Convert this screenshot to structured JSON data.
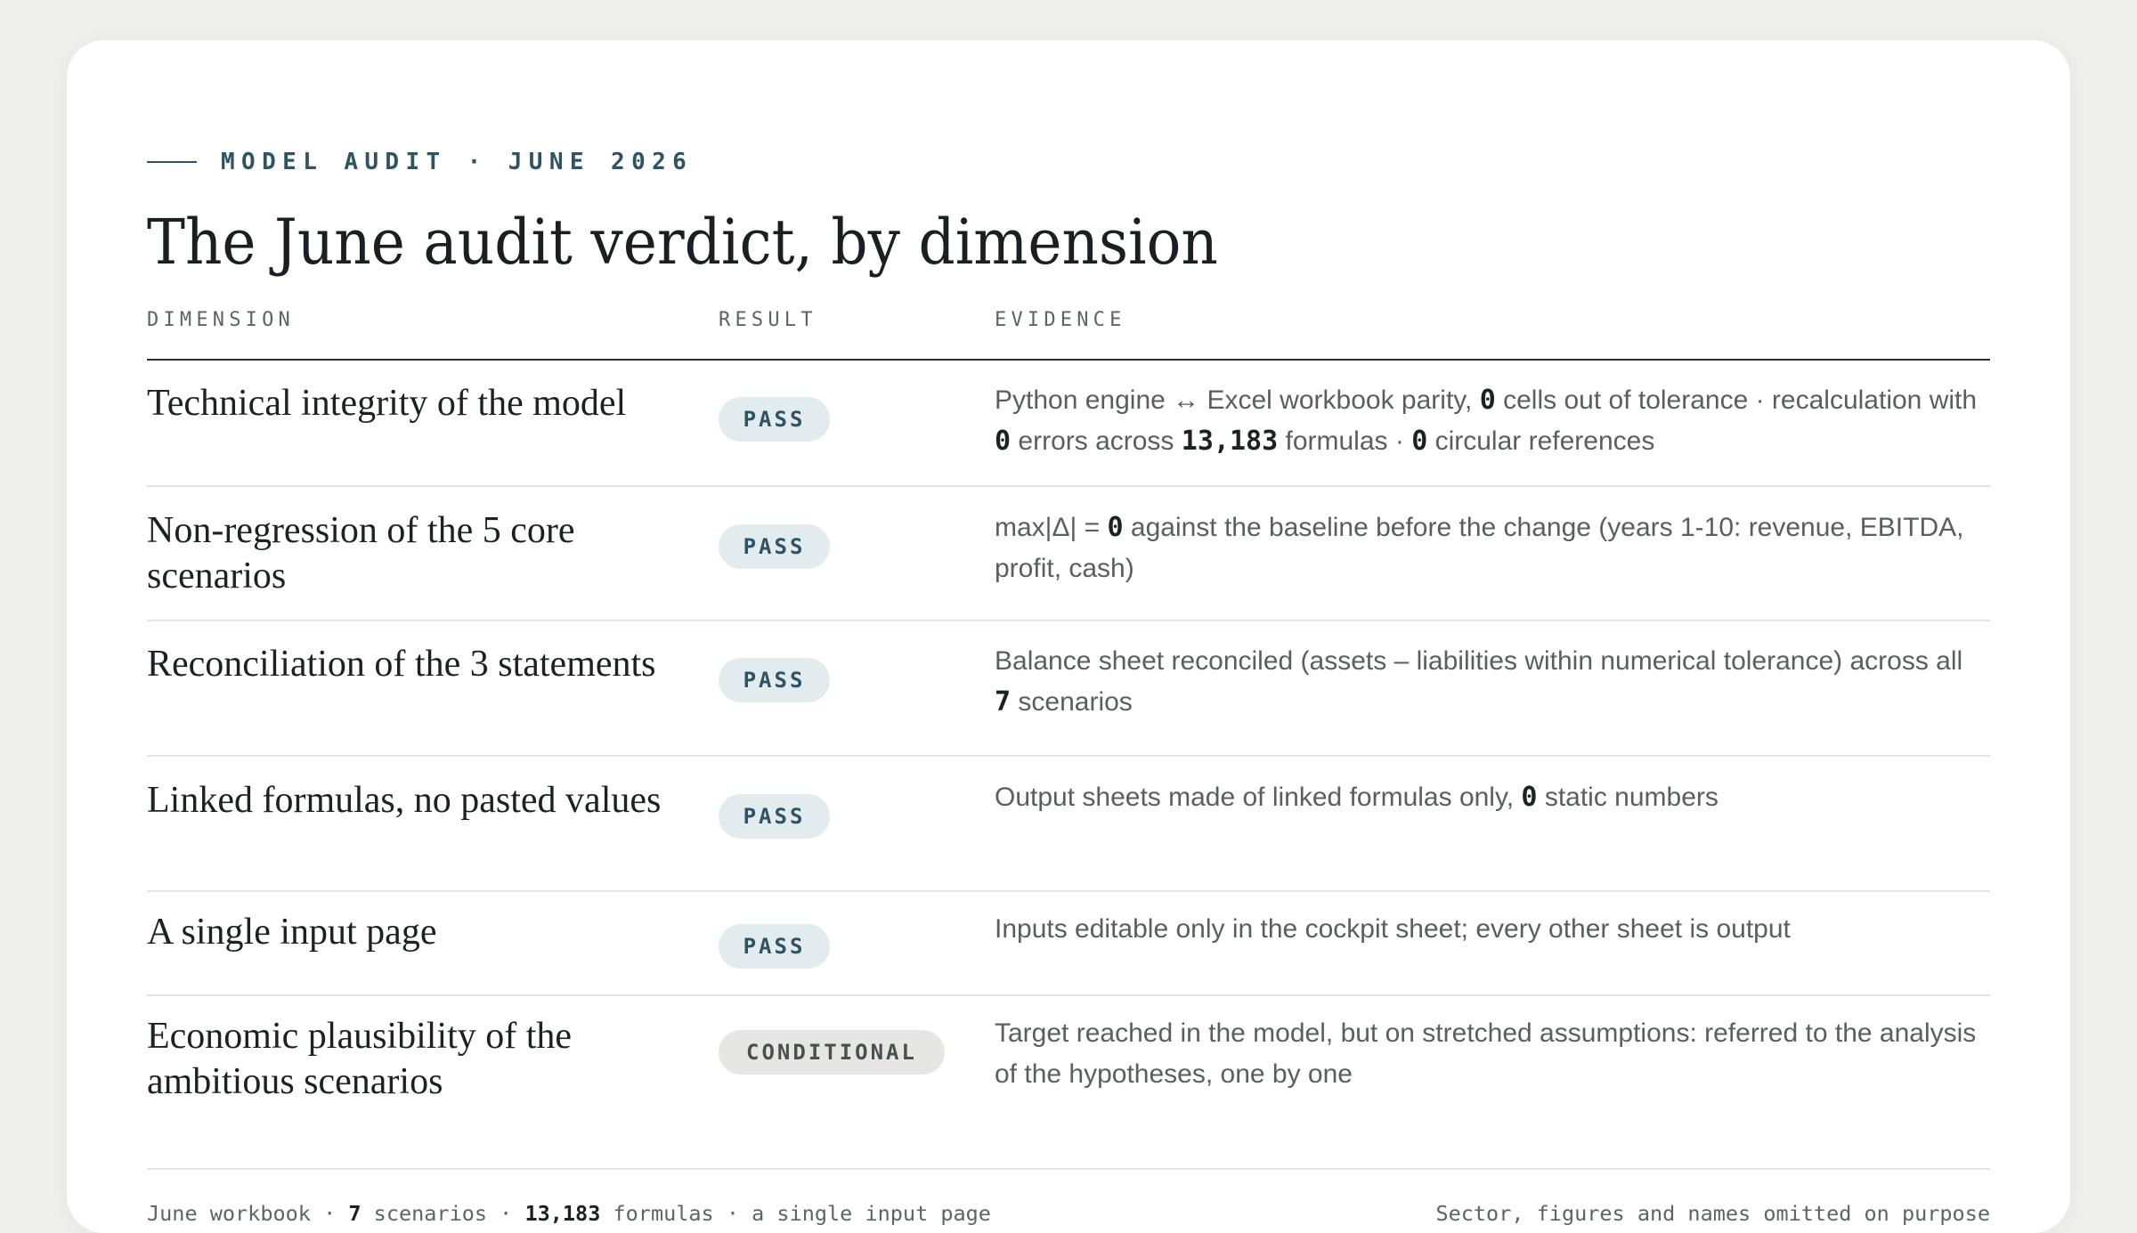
{
  "eyebrow": "MODEL AUDIT · JUNE 2026",
  "title": "The June audit verdict, by dimension",
  "columns": {
    "dimension": "DIMENSION",
    "result": "RESULT",
    "evidence": "EVIDENCE"
  },
  "rows": [
    {
      "dimension": "Technical integrity of the model",
      "result": "PASS",
      "evidence": {
        "t1": "Python engine ↔ Excel workbook parity, ",
        "n1": "0",
        "t2": " cells out of tolerance · recalculation with ",
        "n2": "0",
        "t3": " errors across ",
        "n3": "13,183",
        "t4": " formulas · ",
        "n4": "0",
        "t5": " circular references"
      }
    },
    {
      "dimension": "Non-regression of the 5 core scenarios",
      "result": "PASS",
      "evidence": {
        "t1": "max|Δ| = ",
        "n1": "0",
        "t2": " against the baseline before the change (years 1-10: revenue, EBITDA, profit, cash)"
      }
    },
    {
      "dimension": "Reconciliation of the 3 statements",
      "result": "PASS",
      "evidence": {
        "t1": "Balance sheet reconciled (assets – liabilities within numerical tolerance) across all ",
        "n1": "7",
        "t2": " scenarios"
      }
    },
    {
      "dimension": "Linked formulas, no pasted values",
      "result": "PASS",
      "evidence": {
        "t1": "Output sheets made of linked formulas only, ",
        "n1": "0",
        "t2": " static numbers"
      }
    },
    {
      "dimension": "A single input page",
      "result": "PASS",
      "evidence": {
        "t1": "Inputs editable only in the cockpit sheet; every other sheet is output"
      }
    },
    {
      "dimension": "Economic plausibility of the ambitious scenarios",
      "result": "CONDITIONAL",
      "evidence": {
        "t1": "Target reached in the model, but on stretched assumptions: referred to the analysis of the hypotheses, one by one"
      }
    }
  ],
  "footer": {
    "left": {
      "t1": "June workbook · ",
      "n1": "7",
      "t2": " scenarios · ",
      "n2": "13,183",
      "t3": " formulas · a single input page"
    },
    "right": "Sector, figures and names omitted on purpose"
  },
  "colors": {
    "accent": "#2e5363",
    "pass_badge_bg": "#e2ebee",
    "conditional_badge_bg": "#e6e7e3",
    "page_bg": "#eff0ee"
  }
}
